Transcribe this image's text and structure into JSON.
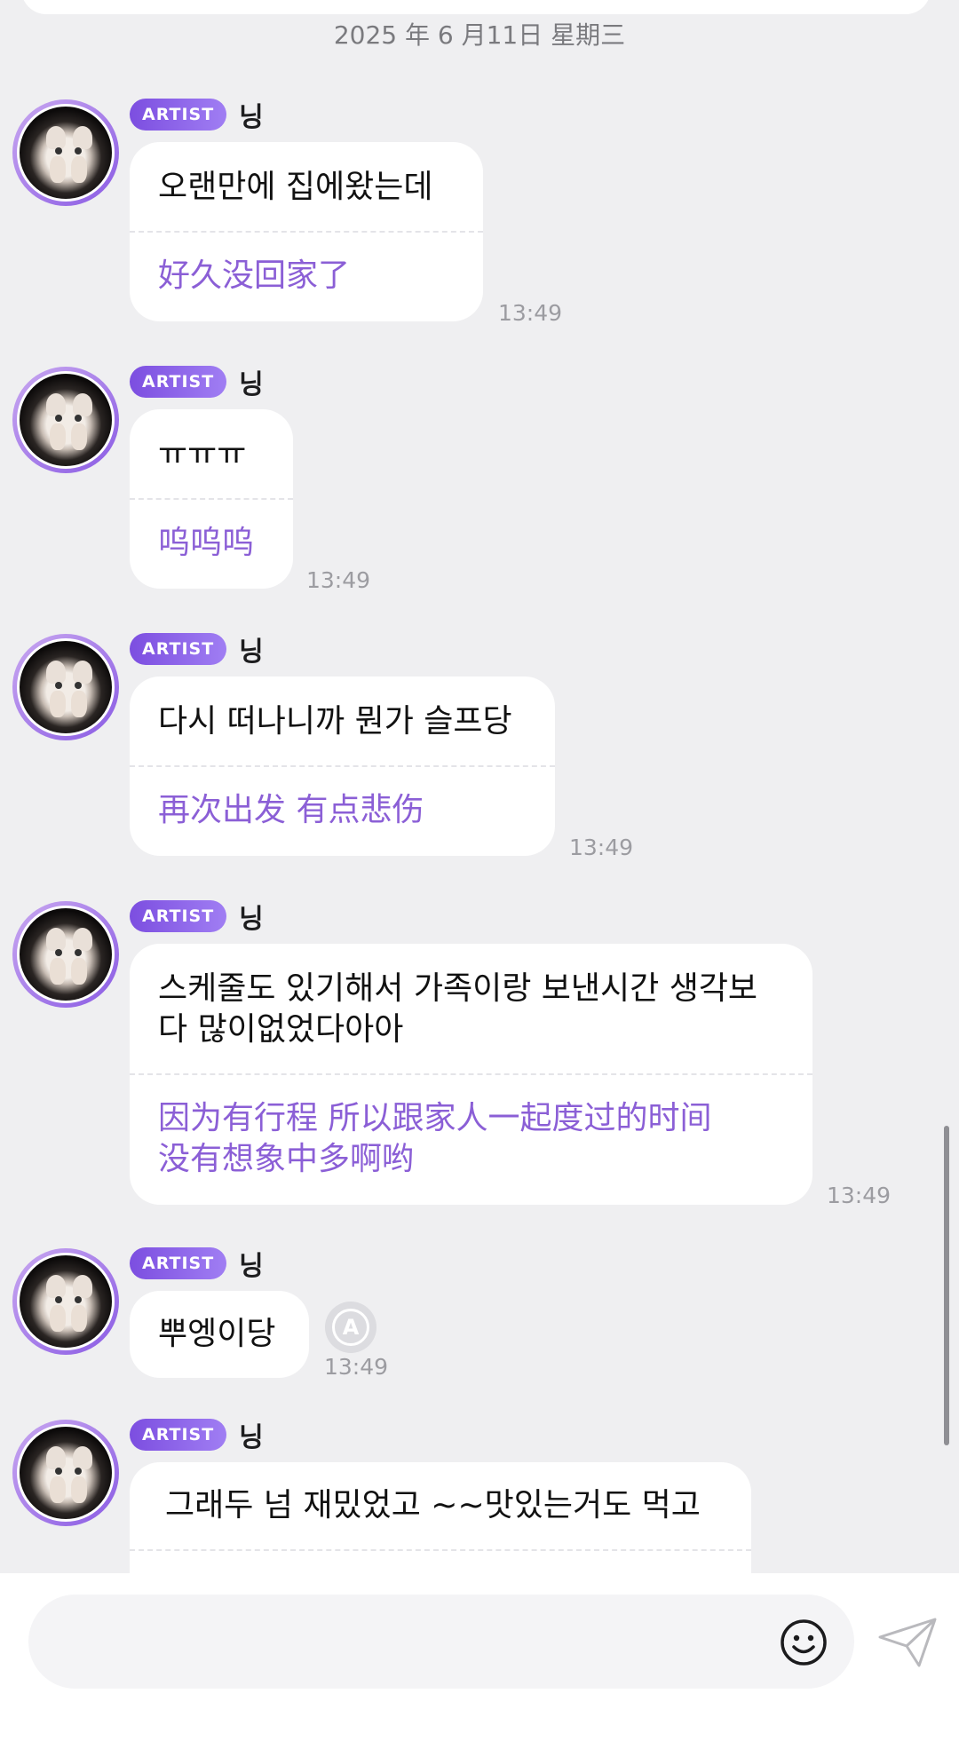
{
  "date_header": "2025 年 6 月11日  星期三",
  "messages": [
    {
      "badge": "ARTIST",
      "name": "닝",
      "ko": "오랜만에 집에왔는데",
      "zh": "好久没回家了",
      "time": "13:49"
    },
    {
      "badge": "ARTIST",
      "name": "닝",
      "ko": "ㅠㅠㅠ",
      "zh": "呜呜呜",
      "time": "13:49"
    },
    {
      "badge": "ARTIST",
      "name": "닝",
      "ko": "다시 떠나니까 뭔가 슬프당",
      "zh": "再次出发 有点悲伤",
      "time": "13:49"
    },
    {
      "badge": "ARTIST",
      "name": "닝",
      "ko": "스케줄도 있기해서 가족이랑 보낸시간 생각보\n다 많이없었다아아",
      "zh": "因为有行程 所以跟家人一起度过的时间\n没有想象中多啊哟",
      "time": "13:49"
    },
    {
      "badge": "ARTIST",
      "name": "닝",
      "ko": "뿌엥이당",
      "zh": "",
      "time": "13:49",
      "translate_icon": "translate-icon"
    },
    {
      "badge": "ARTIST",
      "name": "닝",
      "ko": "그래두 넘 재밌었고 ~~맛있는거도 먹고",
      "zh": "",
      "time": ""
    }
  ],
  "composer": {
    "placeholder": "",
    "emoji_icon": "smiley-icon",
    "send_icon": "paper-plane-icon"
  },
  "colors": {
    "accent": "#8b5fd6",
    "badge_start": "#7c4ee0",
    "background": "#efeff1"
  }
}
